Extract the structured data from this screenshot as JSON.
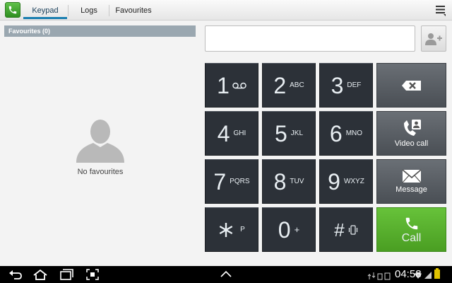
{
  "tabs": [
    {
      "label": "Keypad",
      "active": true
    },
    {
      "label": "Logs",
      "active": false
    },
    {
      "label": "Favourites",
      "active": false
    }
  ],
  "favourites": {
    "header": "Favourites (0)",
    "empty_text": "No favourites"
  },
  "dial_input": {
    "value": "",
    "placeholder": ""
  },
  "keypad": {
    "keys": [
      {
        "digit": "1",
        "letters": "",
        "icon": "voicemail-icon"
      },
      {
        "digit": "2",
        "letters": "ABC"
      },
      {
        "digit": "3",
        "letters": "DEF"
      },
      {
        "digit": "4",
        "letters": "GHI"
      },
      {
        "digit": "5",
        "letters": "JKL"
      },
      {
        "digit": "6",
        "letters": "MNO"
      },
      {
        "digit": "7",
        "letters": "PQRS"
      },
      {
        "digit": "8",
        "letters": "TUV"
      },
      {
        "digit": "9",
        "letters": "WXYZ"
      },
      {
        "digit": "*",
        "letters": "P"
      },
      {
        "digit": "0",
        "letters": "+"
      },
      {
        "digit": "#",
        "letters": "",
        "icon": "vibrate-icon"
      }
    ],
    "actions": {
      "delete_icon": "backspace-icon",
      "video_call_label": "Video call",
      "message_label": "Message",
      "call_label": "Call"
    }
  },
  "status_bar": {
    "time": "04:58"
  },
  "colors": {
    "accent_tab": "#1a7fb0",
    "key_bg": "#2c3138",
    "call_green": "#4a9e22",
    "fav_header_bg": "#9aa7b0"
  }
}
